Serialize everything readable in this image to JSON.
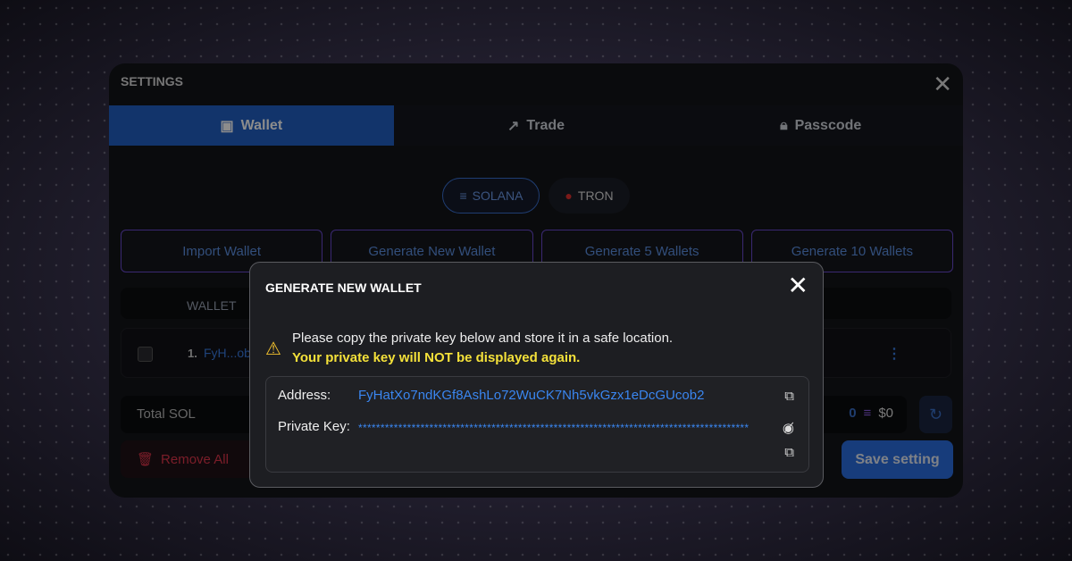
{
  "settings": {
    "title": "SETTINGS",
    "tabs": [
      {
        "label": "Wallet",
        "icon": "wallet-icon"
      },
      {
        "label": "Trade",
        "icon": "chart-line-icon"
      },
      {
        "label": "Passcode",
        "icon": "lock-icon"
      }
    ],
    "chains": [
      {
        "label": "SOLANA"
      },
      {
        "label": "TRON"
      }
    ],
    "actions": [
      "Import Wallet",
      "Generate New Wallet",
      "Generate 5 Wallets",
      "Generate 10 Wallets"
    ],
    "table_header": "WALLET",
    "rows": [
      {
        "num": "1.",
        "address": "FyH...ob2"
      }
    ],
    "total_label": "Total SOL",
    "total_sol": "0",
    "total_usd": "$0",
    "remove_all": "Remove All",
    "save": "Save setting"
  },
  "modal": {
    "title": "GENERATE NEW WALLET",
    "warning": "Please copy the private key below and store it in a safe location.",
    "warning_strong": "Your private key will NOT be displayed again.",
    "address_label": "Address:",
    "address": "FyHatXo7ndKGf8AshLo72WuCK7Nh5vkGzx1eDcGUcob2",
    "private_key_label": "Private Key:",
    "private_key": "****************************************************************************************"
  },
  "colors": {
    "accent": "#2160c4",
    "warning": "#f4e13a",
    "danger": "#e0364b",
    "link": "#3a86f0"
  }
}
